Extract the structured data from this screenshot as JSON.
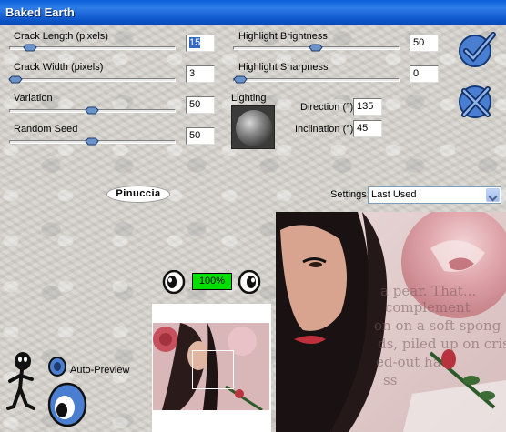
{
  "window": {
    "title": "Baked Earth"
  },
  "params": {
    "crack_length": {
      "label": "Crack Length (pixels)",
      "value": "15",
      "level": 0.15
    },
    "crack_width": {
      "label": "Crack Width (pixels)",
      "value": "3",
      "level": 0.03
    },
    "variation": {
      "label": "Variation",
      "value": "50",
      "level": 0.5
    },
    "random_seed": {
      "label": "Random Seed",
      "value": "50",
      "level": 0.5
    },
    "highlight_brightness": {
      "label": "Highlight Brightness",
      "value": "50",
      "level": 0.5
    },
    "highlight_sharpness": {
      "label": "Highlight Sharpness",
      "value": "0",
      "level": 0.0
    }
  },
  "lighting": {
    "label": "Lighting",
    "direction_label": "Direction (°)",
    "direction_value": "135",
    "inclination_label": "Inclination (°)",
    "inclination_value": "45"
  },
  "logo": {
    "text": "Pinuccia"
  },
  "settings": {
    "label": "Settings:",
    "selected": "Last Used"
  },
  "zoom": {
    "value": "100%"
  },
  "auto_preview": {
    "label": "Auto-Preview"
  },
  "preview": {
    "text_fragments": [
      "a pear. That...",
      "complement",
      "on on a soft spong",
      "ds, piled up on crisp",
      "ed-out ha",
      "ss"
    ]
  },
  "colors": {
    "ok_blue": "#3a6fc4",
    "zoom_green": "#00e000",
    "title_blue": "#0a5fd8"
  }
}
